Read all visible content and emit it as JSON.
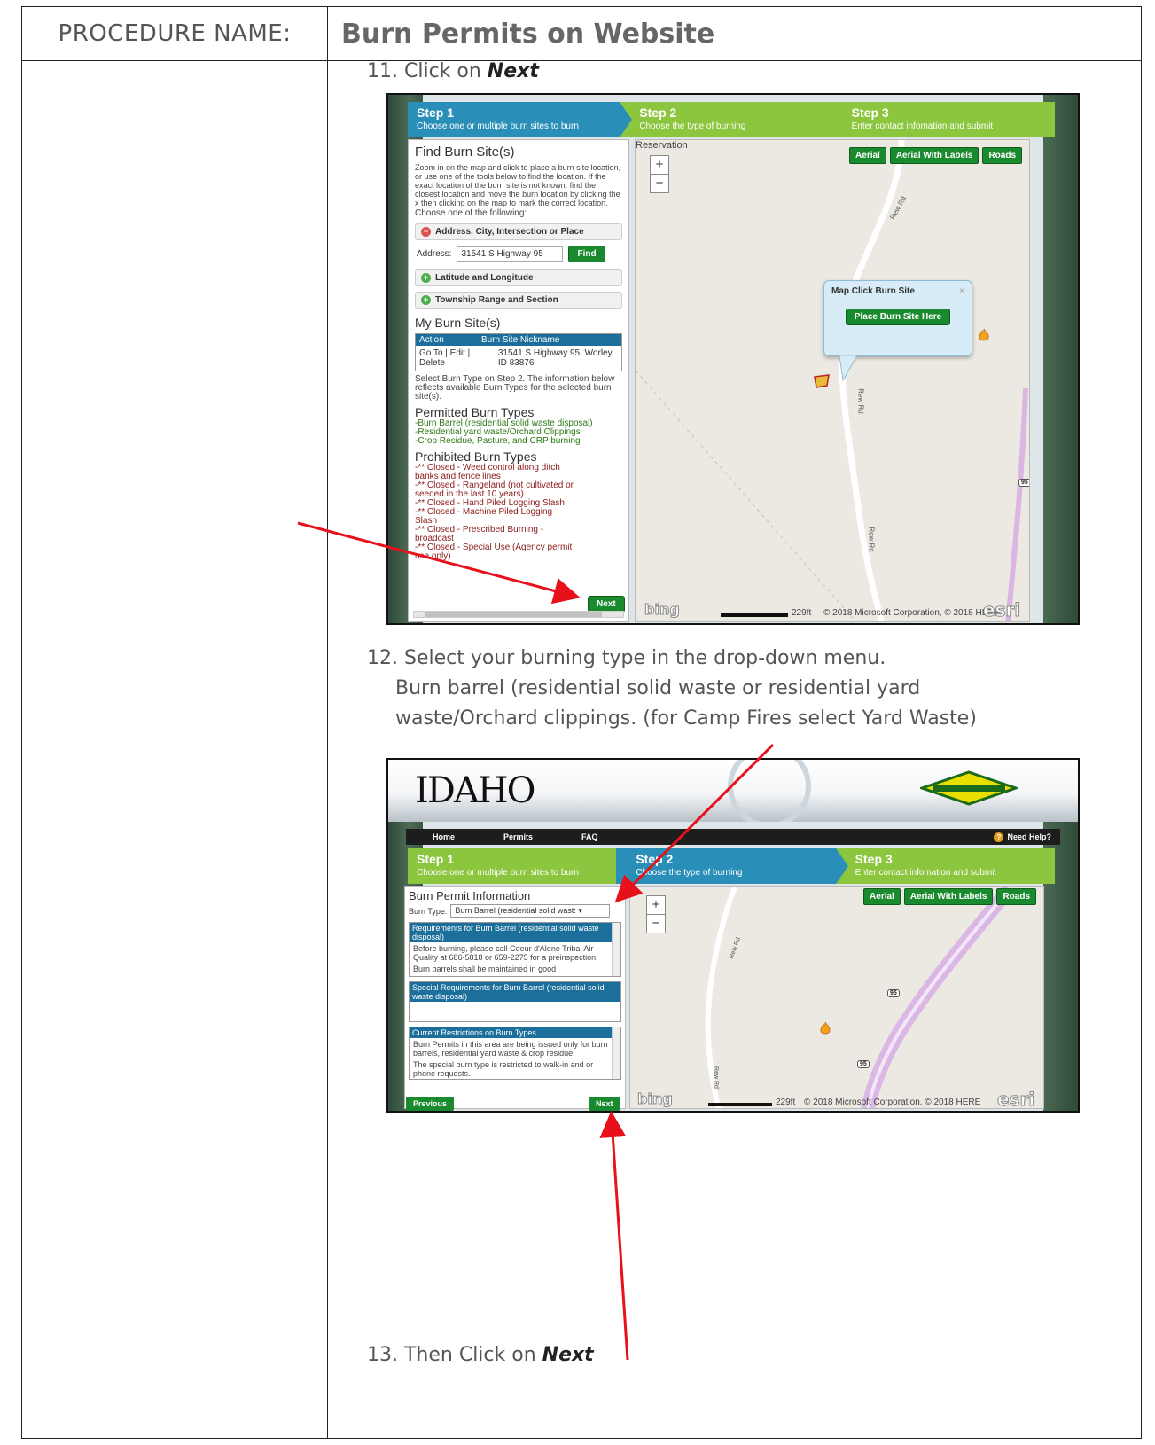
{
  "procedure": {
    "label": "PROCEDURE NAME:",
    "title": "Burn Permits on Website"
  },
  "steps": {
    "s11_prefix": "11. Click on ",
    "s11_bold": "Next",
    "s12_line1": "12. Select your burning type in the drop-down menu.",
    "s12_line2": "Burn barrel (residential solid waste or residential yard",
    "s12_line3": "waste/Orchard clippings. (for Camp Fires select Yard Waste)",
    "s13_prefix": "13. Then Click on ",
    "s13_bold": "Next"
  },
  "wizard": {
    "step1_title": "Step 1",
    "step1_sub": "Choose one or multiple burn sites to burn",
    "step2_title": "Step 2",
    "step2_sub": "Choose the type of burning",
    "step3_title": "Step 3",
    "step3_sub": "Enter contact infomation and submit"
  },
  "shot1": {
    "heading": "Find Burn Site(s)",
    "intro": "Zoom in on the map and click to place a burn site location, or use one of the tools below to find the location. If the exact location of the burn site is not known, find the closest location and move the burn location by clicking the x then clicking on the map to mark the correct location.",
    "choose": "Choose one of the following:",
    "acc_address": "Address, City, Intersection or Place",
    "address_label": "Address:",
    "address_value": "31541 S Highway 95",
    "find_btn": "Find",
    "acc_latlon": "Latitude and Longitude",
    "acc_township": "Township Range and Section",
    "my_sites": "My Burn Site(s)",
    "col_action": "Action",
    "col_nickname": "Burn Site Nickname",
    "row_actions": "Go To | Edit | Delete",
    "row_site": "31541 S Highway 95, Worley, ID 83876",
    "select_note": "Select Burn Type on Step 2. The information below reflects available Burn Types for the selected burn site(s).",
    "permitted_head": "Permitted Burn Types",
    "permitted": [
      "-Burn Barrel (residential solid waste disposal)",
      "-Residential yard waste/Orchard Clippings",
      "-Crop Residue, Pasture, and CRP burning"
    ],
    "prohibited_head": "Prohibited Burn Types",
    "prohibited": [
      "-** Closed - Weed control along ditch banks and fence lines",
      "-** Closed - Rangeland (not cultivated or seeded in the last 10 years)",
      "-** Closed - Hand Piled Logging Slash",
      "-** Closed - Machine Piled Logging Slash",
      "-** Closed - Prescribed Burning - broadcast",
      "-** Closed - Special Use (Agency permit use only)"
    ],
    "next_btn": "Next",
    "map_reservation": "Reservation",
    "map_btn_aerial": "Aerial",
    "map_btn_aerial_labels": "Aerial With Labels",
    "map_btn_roads": "Roads",
    "popup_title": "Map Click Burn Site",
    "popup_close": "×",
    "popup_btn": "Place Burn Site Here",
    "road_label_1": "Rew Rd",
    "road_label_2": "Rew Rd",
    "road_label_3": "Rew Rd",
    "hwy_label": "95",
    "zoom_in": "+",
    "zoom_out": "−",
    "bing": "bing",
    "scale": "229ft",
    "credits": "© 2018 Microsoft Corporation, © 2018 HERE",
    "esri": "esri"
  },
  "shot2": {
    "logo": "IDAHO",
    "nav_home": "Home",
    "nav_permits": "Permits",
    "nav_faq": "FAQ",
    "nav_help": "Need Help?",
    "heading": "Burn Permit Information",
    "burn_type_label": "Burn Type:",
    "burn_type_value": "Burn Barrel (residential solid wast: ▾",
    "req_head": "Requirements for Burn Barrel (residential solid waste disposal)",
    "req_body1": "Before burning, please call Coeur d'Alene Tribal Air Quality at 686-5818 or 659-2275 for a preinspection.",
    "req_body2": "Burn barrels shall be maintained in good",
    "special_head": "Special Requirements for Burn Barrel (residential solid waste disposal)",
    "restr_head": "Current Restrictions on Burn Types",
    "restr_body1": "Burn Permits in this area are being issued only for burn barrels, residential yard waste & crop residue.",
    "restr_body2": "The special burn type is restricted to walk-in and or phone requests.",
    "prev_btn": "Previous",
    "next_btn": "Next",
    "map_btn_aerial": "Aerial",
    "map_btn_aerial_labels": "Aerial With Labels",
    "map_btn_roads": "Roads",
    "road_label_1": "Rew Rd",
    "road_label_2": "Rew Rd",
    "hwy_label_1": "95",
    "hwy_label_2": "95",
    "zoom_in": "+",
    "zoom_out": "−",
    "bing": "bing",
    "scale": "229ft",
    "credits": "© 2018 Microsoft Corporation, © 2018 HERE",
    "esri": "esri"
  },
  "colors": {
    "step_active": "#2a8fb8",
    "step_inactive": "#8cc63f",
    "button_green": "#1a8a2e",
    "arrow_red": "#e8101a"
  }
}
